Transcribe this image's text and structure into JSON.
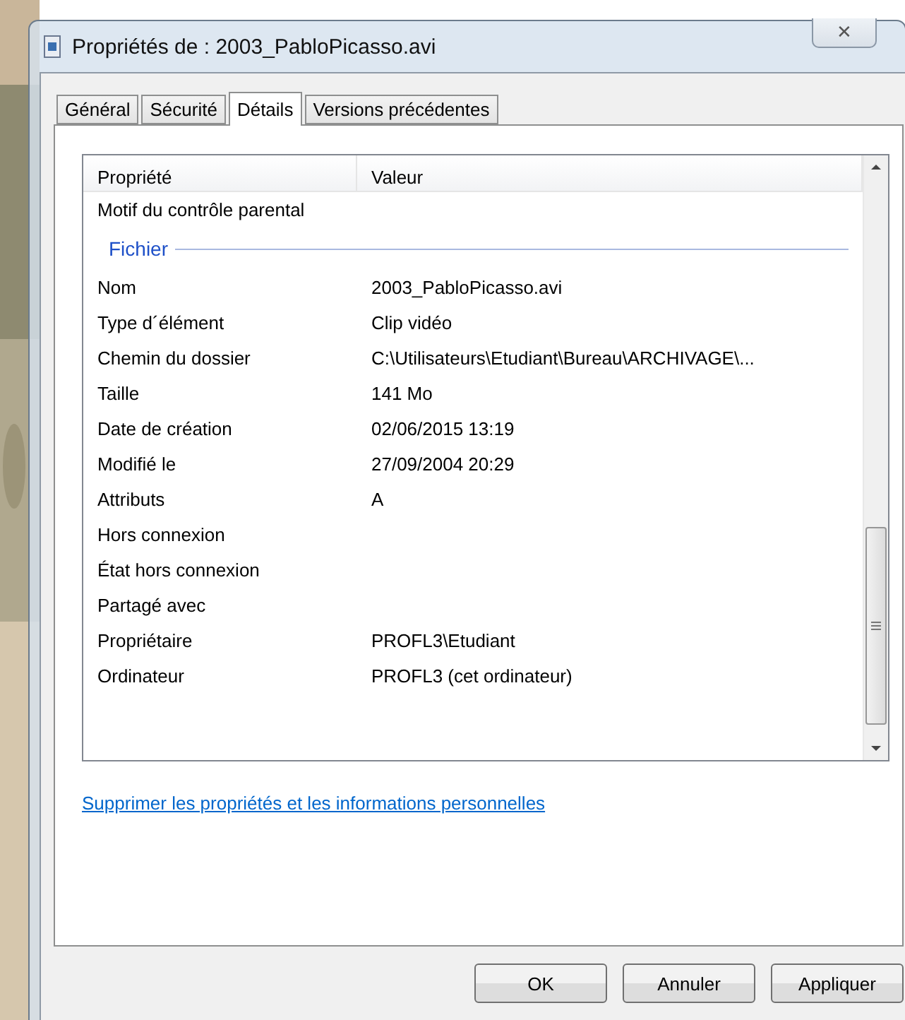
{
  "window": {
    "title": "Propriétés de : 2003_PabloPicasso.avi",
    "close": "✕"
  },
  "tabs": [
    {
      "label": "Général",
      "selected": false
    },
    {
      "label": "Sécurité",
      "selected": false
    },
    {
      "label": "Détails",
      "selected": true
    },
    {
      "label": "Versions précédentes",
      "selected": false
    }
  ],
  "table": {
    "columns": [
      "Propriété",
      "Valeur"
    ],
    "rows": [
      {
        "kind": "row",
        "property": "Motif du contrôle parental",
        "value": ""
      },
      {
        "kind": "group",
        "property": "Fichier"
      },
      {
        "kind": "row",
        "property": "Nom",
        "value": "2003_PabloPicasso.avi"
      },
      {
        "kind": "row",
        "property": "Type d´élément",
        "value": "Clip vidéo"
      },
      {
        "kind": "row",
        "property": "Chemin du dossier",
        "value": "C:\\Utilisateurs\\Etudiant\\Bureau\\ARCHIVAGE\\..."
      },
      {
        "kind": "row",
        "property": "Taille",
        "value": "141 Mo"
      },
      {
        "kind": "row",
        "property": "Date de création",
        "value": "02/06/2015 13:19"
      },
      {
        "kind": "row",
        "property": "Modifié le",
        "value": "27/09/2004 20:29"
      },
      {
        "kind": "row",
        "property": "Attributs",
        "value": "A"
      },
      {
        "kind": "row",
        "property": "Hors connexion",
        "value": ""
      },
      {
        "kind": "row",
        "property": "État hors connexion",
        "value": ""
      },
      {
        "kind": "row",
        "property": "Partagé avec",
        "value": ""
      },
      {
        "kind": "row",
        "property": "Propriétaire",
        "value": "PROFL3\\Etudiant"
      },
      {
        "kind": "row",
        "property": "Ordinateur",
        "value": "PROFL3 (cet ordinateur)"
      }
    ]
  },
  "link": "Supprimer les propriétés et les informations personnelles",
  "buttons": [
    "OK",
    "Annuler",
    "Appliquer"
  ]
}
